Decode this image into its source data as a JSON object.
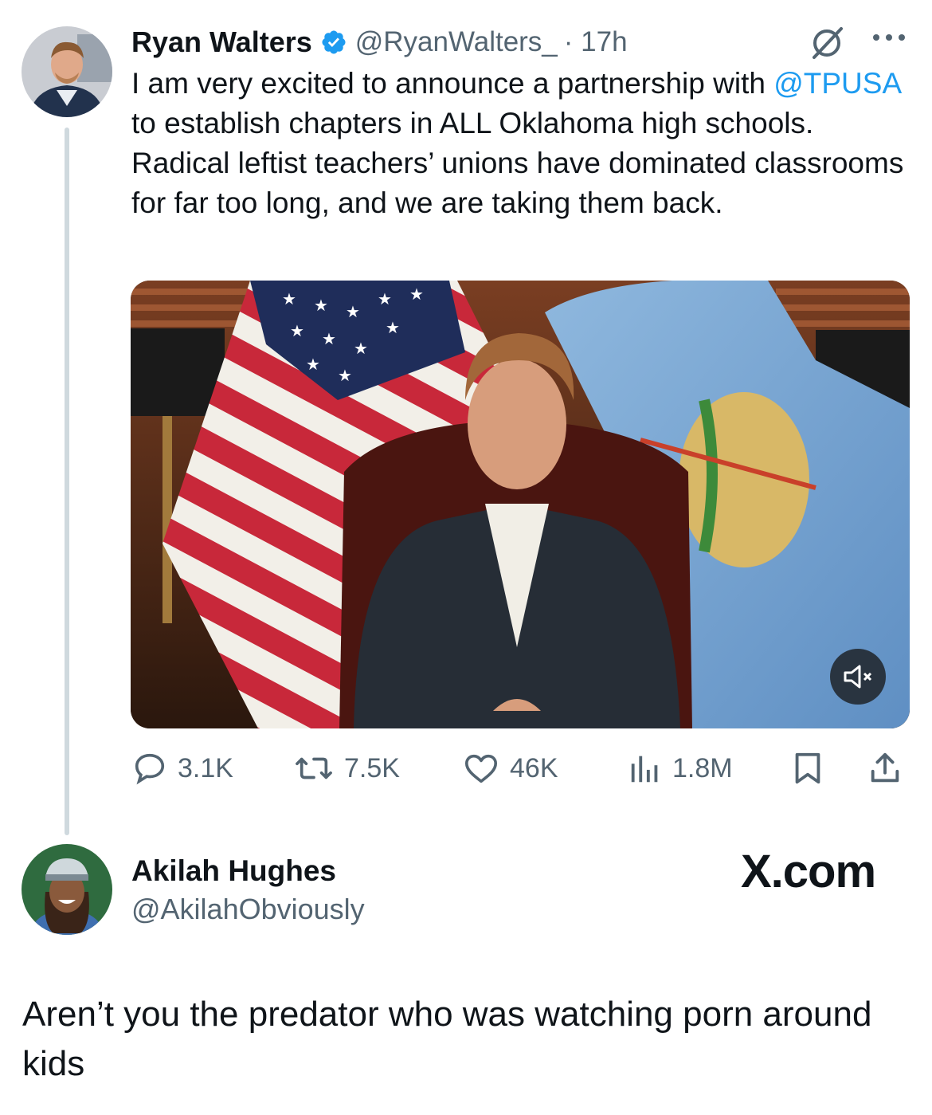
{
  "tweet": {
    "author_name": "Ryan Walters",
    "handle": "@RyanWalters_",
    "time": "· 17h",
    "text_before": "I am very excited to announce a partnership with ",
    "mention": "@TPUSA",
    "text_after": " to establish chapters in ALL Oklahoma high schools. Radical leftist teachers’ unions have dominated classrooms for far too long, and we are taking them back."
  },
  "actions": {
    "replies": "3.1K",
    "reposts": "7.5K",
    "likes": "46K",
    "views": "1.8M"
  },
  "reply": {
    "author_name": "Akilah Hughes",
    "handle": "@AkilahObviously",
    "brand": "X.com",
    "text": "Aren’t you the predator who was watching porn around kids"
  },
  "colors": {
    "link": "#1d9bf0",
    "secondary_text": "#536471",
    "thread_line": "#cfd9de"
  },
  "icons": [
    "verified-badge-icon",
    "grok-icon",
    "more-icon",
    "reply-icon",
    "repost-icon",
    "like-icon",
    "views-icon",
    "bookmark-icon",
    "share-icon",
    "mute-icon"
  ]
}
